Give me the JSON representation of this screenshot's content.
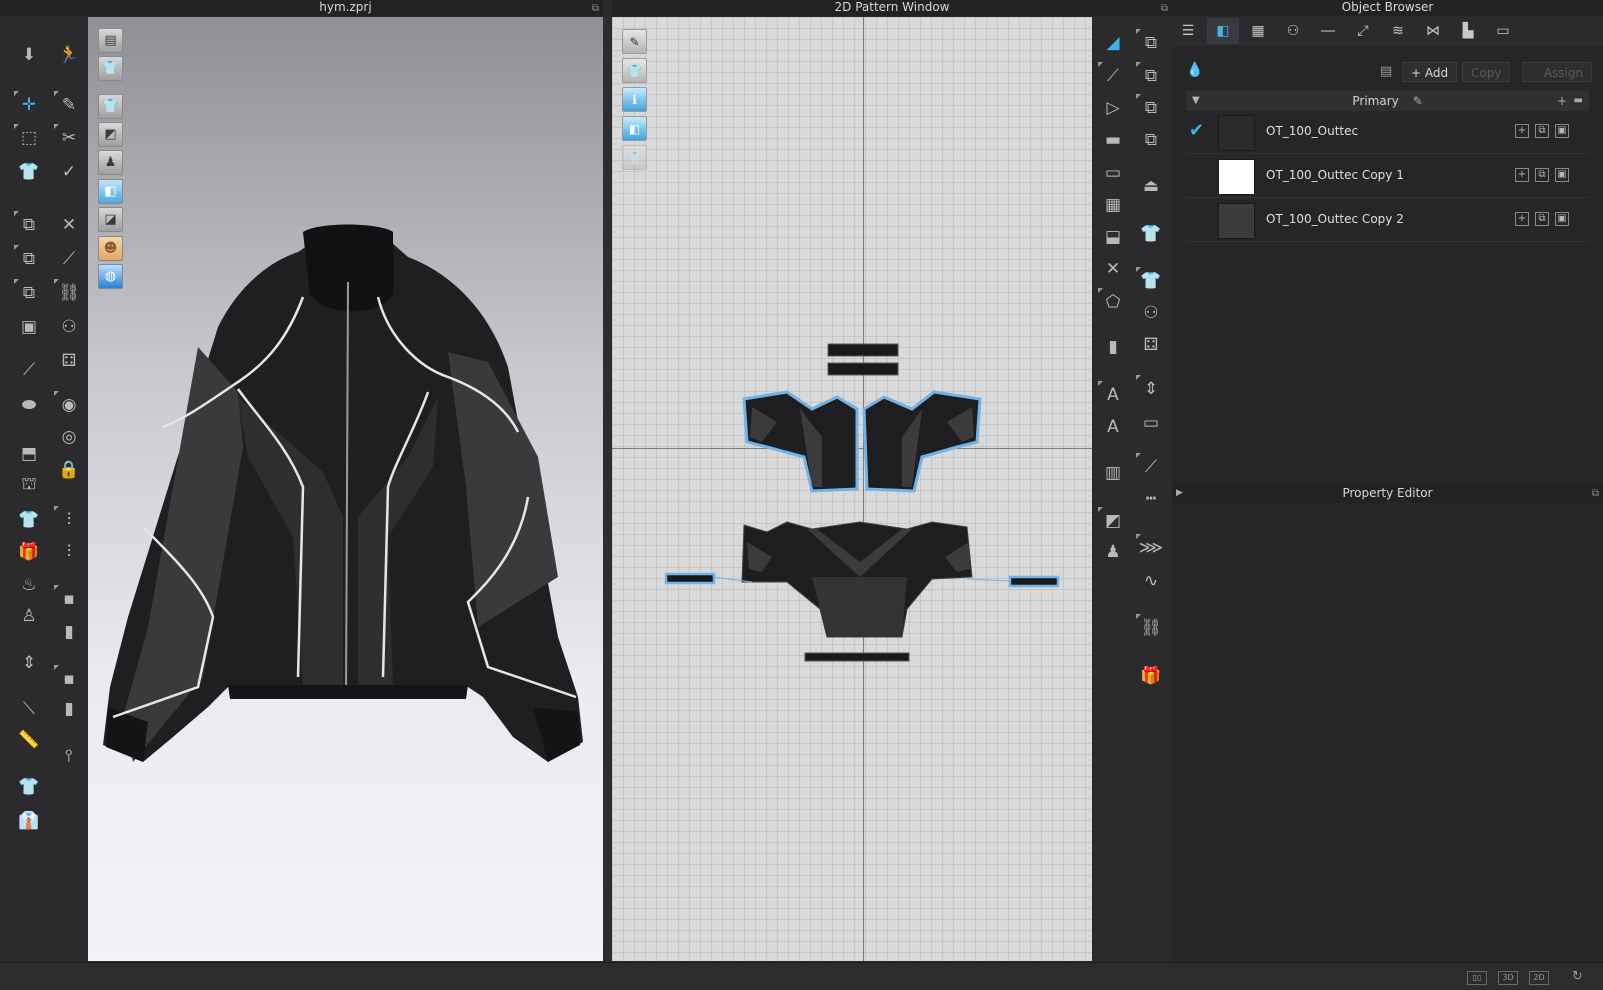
{
  "windows": {
    "viewport3d_title": "hym.zprj",
    "pattern_title": "2D Pattern Window",
    "object_browser_title": "Object Browser",
    "property_editor_title": "Property Editor"
  },
  "object_browser": {
    "add_label": "+ Add",
    "copy_label": "Copy",
    "assign_label": "Assign",
    "group_label": "Primary",
    "items": [
      {
        "name": "OT_100_Outtec",
        "swatch": "#2a2a2b",
        "checked": true
      },
      {
        "name": "OT_100_Outtec Copy 1",
        "swatch": "#ffffff",
        "checked": false
      },
      {
        "name": "OT_100_Outtec Copy 2",
        "swatch": "#3c3c3e",
        "checked": false
      }
    ]
  },
  "statusbar": {
    "view_3d": "3D",
    "view_2d": "2D"
  },
  "colors": {
    "accent": "#3fb3ea",
    "pattern_outline": "#6fb3e8",
    "fabric_dark": "#1f1f21",
    "fabric_mid": "#3b3b3e"
  }
}
